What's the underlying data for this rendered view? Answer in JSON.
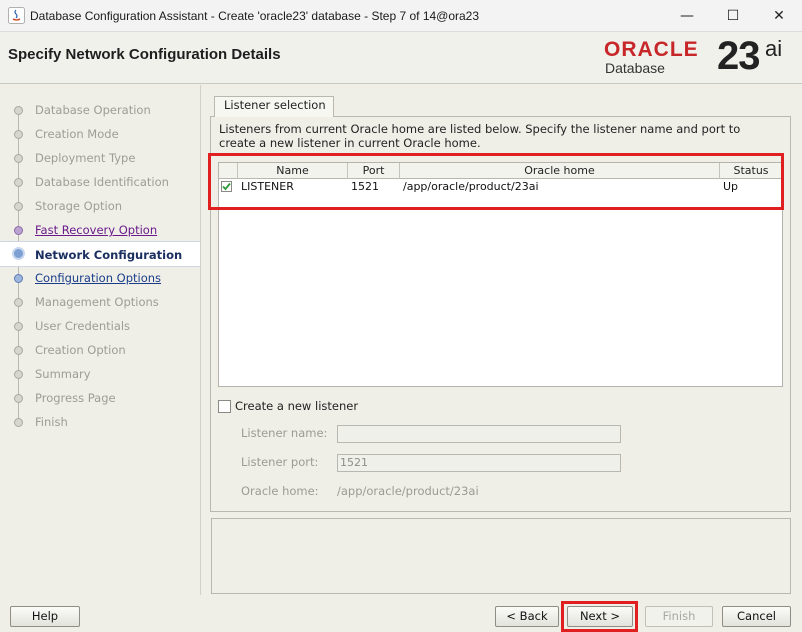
{
  "window": {
    "title": "Database Configuration Assistant - Create 'oracle23' database - Step 7 of 14@ora23",
    "minimize": "—",
    "maximize": "☐",
    "close": "✕"
  },
  "header": {
    "page_title": "Specify Network Configuration Details",
    "brand": "ORACLE",
    "product": "Database",
    "version_number": "23",
    "version_suffix": "ai"
  },
  "steps": [
    {
      "label": "Database Operation",
      "state": "disabled"
    },
    {
      "label": "Creation Mode",
      "state": "disabled"
    },
    {
      "label": "Deployment Type",
      "state": "disabled"
    },
    {
      "label": "Database Identification",
      "state": "disabled"
    },
    {
      "label": "Storage Option",
      "state": "disabled"
    },
    {
      "label": "Fast Recovery Option",
      "state": "visited"
    },
    {
      "label": "Network Configuration",
      "state": "current"
    },
    {
      "label": "Configuration Options",
      "state": "link"
    },
    {
      "label": "Management Options",
      "state": "disabled"
    },
    {
      "label": "User Credentials",
      "state": "disabled"
    },
    {
      "label": "Creation Option",
      "state": "disabled"
    },
    {
      "label": "Summary",
      "state": "disabled"
    },
    {
      "label": "Progress Page",
      "state": "disabled"
    },
    {
      "label": "Finish",
      "state": "disabled"
    }
  ],
  "tab": {
    "label": "Listener selection"
  },
  "description": "Listeners from current Oracle home are listed below. Specify the listener name and port to create a new listener in current Oracle home.",
  "listener_table": {
    "columns": [
      "Name",
      "Port",
      "Oracle home",
      "Status"
    ],
    "rows": [
      {
        "checked": true,
        "name": "LISTENER",
        "port": "1521",
        "oracle_home": "/app/oracle/product/23ai",
        "status": "Up"
      }
    ]
  },
  "new_listener": {
    "checkbox_label": "Create a new listener",
    "checked": false,
    "name_label": "Listener name:",
    "name_value": "",
    "port_label": "Listener port:",
    "port_value": "1521",
    "home_label": "Oracle home:",
    "home_value": "/app/oracle/product/23ai"
  },
  "buttons": {
    "help": "Help",
    "back": "< Back",
    "next": "Next >",
    "finish": "Finish",
    "cancel": "Cancel"
  },
  "colors": {
    "oracle_red": "#c8272a",
    "highlight_red": "#e02020",
    "current_step_text": "#1b2f61",
    "visited_link": "#6a1a8a"
  }
}
